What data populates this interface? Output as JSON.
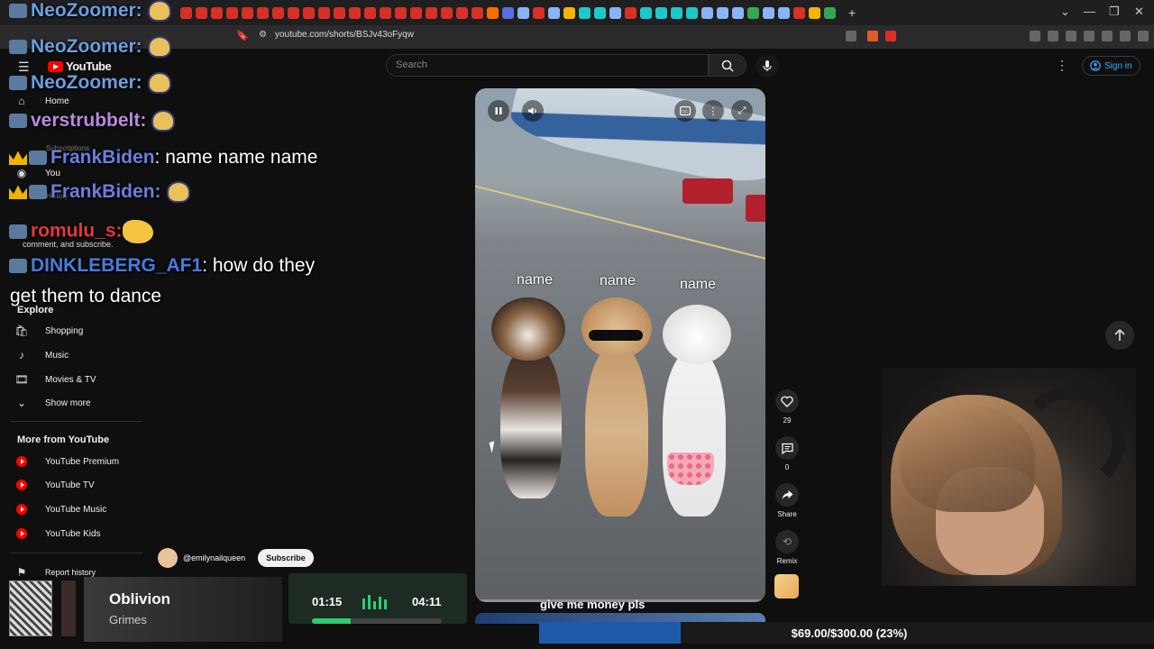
{
  "browser": {
    "url": "youtube.com/shorts/BSJv43oFyqw",
    "tab_favicon_colors": [
      "#d93025",
      "#d93025",
      "#d93025",
      "#d93025",
      "#d93025",
      "#d93025",
      "#d93025",
      "#d93025",
      "#d93025",
      "#d93025",
      "#d93025",
      "#d93025",
      "#d93025",
      "#d93025",
      "#d93025",
      "#d93025",
      "#d93025",
      "#d93025",
      "#d93025",
      "#d93025",
      "#ff6d00",
      "#5b6ee1",
      "#8ab4f8",
      "#d93025",
      "#8ab4f8",
      "#f4b400",
      "#1ec8c8",
      "#1ec8c8",
      "#8ab4f8",
      "#d93025",
      "#1ec8c8",
      "#1ec8c8",
      "#1ec8c8",
      "#1ec8c8",
      "#8ab4f8",
      "#8ab4f8",
      "#8ab4f8",
      "#34a853",
      "#8ab4f8",
      "#8ab4f8",
      "#d93025",
      "#f4b400",
      "#34a853"
    ]
  },
  "youtube": {
    "logo_text": "YouTube",
    "search_placeholder": "Search",
    "sign_in": "Sign in",
    "colors": {
      "brand": "#ff0000",
      "link": "#3ea6ff",
      "background": "#0f0f0f"
    }
  },
  "sidebar": {
    "top": [
      {
        "label": "Home",
        "icon": "home-icon"
      },
      {
        "label": "Subscriptions",
        "icon": "subscriptions-icon"
      },
      {
        "label": "You",
        "icon": "you-icon"
      },
      {
        "label": "History",
        "icon": "history-icon"
      }
    ],
    "signin_note": "comment, and subscribe.",
    "explore_heading": "Explore",
    "explore": [
      {
        "label": "Shopping",
        "icon": "shopping-icon"
      },
      {
        "label": "Music",
        "icon": "music-icon"
      },
      {
        "label": "Movies & TV",
        "icon": "movies-icon"
      },
      {
        "label": "Show more",
        "icon": "chevron-down-icon"
      }
    ],
    "more_heading": "More from YouTube",
    "more": [
      {
        "label": "YouTube Premium"
      },
      {
        "label": "YouTube TV"
      },
      {
        "label": "YouTube Music"
      },
      {
        "label": "YouTube Kids"
      }
    ],
    "report_history": "Report history"
  },
  "chat": [
    {
      "user": "NeoZoomer:",
      "color": "#6a9fe0",
      "text": ""
    },
    {
      "user": "NeoZoomer:",
      "color": "#6a9fe0",
      "text": ""
    },
    {
      "user": "NeoZoomer:",
      "color": "#6a9fe0",
      "text": ""
    },
    {
      "user": "verstrubbelt:",
      "color": "#b88ae0",
      "text": ""
    },
    {
      "user": "FrankBiden",
      "color": "#6a7fe0",
      "text": ": name name name"
    },
    {
      "user": "FrankBiden:",
      "color": "#6a7fe0",
      "text": ""
    },
    {
      "user": "romulu_s:",
      "color": "#e03a3a",
      "text": ""
    },
    {
      "user": "DINKLEBERG_AF1",
      "color": "#4a7ae0",
      "text": ": how do they"
    },
    {
      "user": "",
      "color": "#ffffff",
      "text": "get them to dance"
    }
  ],
  "short": {
    "names": [
      "name",
      "name",
      "name"
    ],
    "caption": "give me money pls",
    "channel": "@emilynailqueen",
    "subscribe": "Subscribe",
    "likes": "29",
    "comments": "0",
    "share": "Share",
    "remix": "Remix"
  },
  "music": {
    "title": "Oblivion",
    "artist": "Grimes",
    "current": "01:15",
    "total": "04:11",
    "progress": 0.3,
    "accent": "#2ecc71"
  },
  "goal": {
    "text": "$69.00/$300.00 (23%)",
    "fraction": 0.23,
    "color": "#1e5aa8"
  }
}
